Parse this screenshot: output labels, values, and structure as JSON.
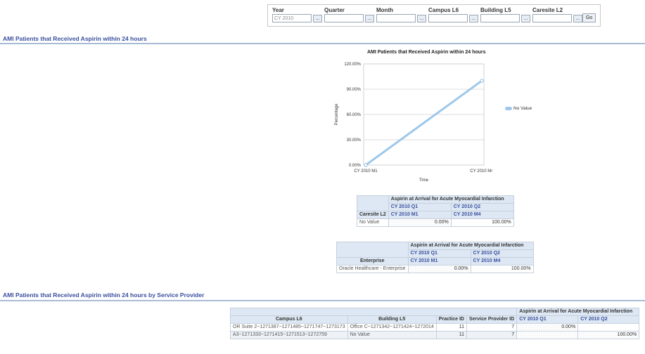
{
  "prompts": {
    "year": {
      "label": "Year",
      "value": "CY 2010"
    },
    "quarter": {
      "label": "Quarter",
      "value": ""
    },
    "month": {
      "label": "Month",
      "value": ""
    },
    "campus": {
      "label": "Campus L6",
      "value": ""
    },
    "building": {
      "label": "Building L5",
      "value": ""
    },
    "caresite": {
      "label": "Caresite L2",
      "value": ""
    },
    "browse_label": "...",
    "go_label": "Go"
  },
  "section1": {
    "title": "AMI Patients that Received Aspirin within 24 hours"
  },
  "section2": {
    "title": "AMI Patients that Received Aspirin within 24 hours by Service Provider"
  },
  "chart_data": {
    "type": "line",
    "title": "AMI Patients that Received Aspirin within 24 hours",
    "xlabel": "Time",
    "ylabel": "Percentage",
    "categories": [
      "CY 2010 M1",
      "CY 2010 M4"
    ],
    "series": [
      {
        "name": "No Value",
        "values": [
          0,
          100
        ]
      }
    ],
    "ylim": [
      0,
      120
    ],
    "yticks": [
      "0.00%",
      "30.00%",
      "60.00%",
      "90.00%",
      "120.00%"
    ],
    "grid": true,
    "legend": "right",
    "color": "#9ec8ea"
  },
  "pivot1": {
    "measure": "Aspirin at Arrival for Acute Myocardial Infarction",
    "q1": "CY 2010 Q1",
    "q2": "CY 2010 Q2",
    "row_header": "Caresite L2",
    "m1": "CY 2010 M1",
    "m4": "CY 2010 M4",
    "row_label": "No Value",
    "v1": "0.00%",
    "v2": "100.00%"
  },
  "pivot2": {
    "measure": "Aspirin at Arrival for Acute Myocardial Infarction",
    "q1": "CY 2010 Q1",
    "q2": "CY 2010 Q2",
    "row_header": "Enterprise",
    "m1": "CY 2010 M1",
    "m4": "CY 2010 M4",
    "row_label": "Oracle Healthcare - Enterprise",
    "v1": "0.00%",
    "v2": "100.00%"
  },
  "provider_table": {
    "measure": "Aspirin at Arrival for Acute Myocardial Infarction",
    "headers": [
      "Campus L6",
      "Building L5",
      "Practice ID",
      "Service Provider ID",
      "CY 2010 Q1",
      "CY 2010 Q2"
    ],
    "rows": [
      {
        "campus": "OR Suite 2~1271387~1271485~1271747~1273173",
        "building": "Office C~1271342~1271424~1272014",
        "practice": "11",
        "provider": "7",
        "q1": "0.00%",
        "q2": ""
      },
      {
        "campus": "A3~1271333~1271415~1271513~1272759",
        "building": "No Value",
        "practice": "11",
        "provider": "7",
        "q1": "",
        "q2": "100.00%"
      }
    ]
  }
}
